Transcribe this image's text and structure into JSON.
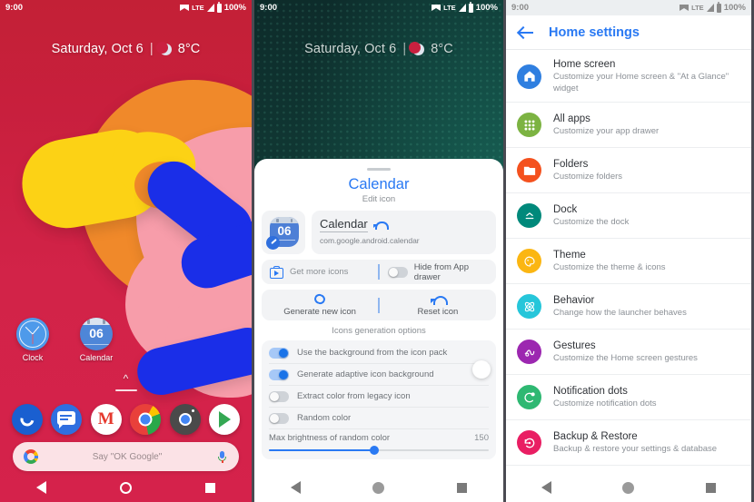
{
  "status_bar": {
    "time": "9:00",
    "network": "LTE",
    "battery": "100%",
    "wifi_icon": "wifi-icon",
    "signal_icon": "signal-icon",
    "battery_icon": "battery-icon"
  },
  "panel1": {
    "at_a_glance": {
      "date": "Saturday, Oct 6",
      "separator": "|",
      "weather_icon": "moon-icon",
      "temperature": "8°C"
    },
    "apps": [
      {
        "label": "Clock",
        "icon": "clock-icon"
      },
      {
        "label": "Calendar",
        "icon": "calendar-icon",
        "day": "06"
      }
    ],
    "page_up_icon": "chevron-up-icon",
    "dock": [
      {
        "name": "Phone",
        "icon": "phone-icon"
      },
      {
        "name": "Messages",
        "icon": "messages-icon"
      },
      {
        "name": "Gmail",
        "icon": "gmail-icon"
      },
      {
        "name": "Chrome",
        "icon": "chrome-icon"
      },
      {
        "name": "Camera",
        "icon": "camera-icon"
      },
      {
        "name": "Play Store",
        "icon": "play-store-icon"
      }
    ],
    "search": {
      "google_icon": "google-g-icon",
      "placeholder": "Say \"OK Google\"",
      "mic_icon": "microphone-icon"
    },
    "nav": {
      "back": "back-icon",
      "home": "home-icon",
      "recents": "recents-icon"
    }
  },
  "panel2": {
    "at_a_glance": {
      "date": "Saturday, Oct 6",
      "separator": "|",
      "weather_icon": "moon-icon",
      "temperature": "8°C"
    },
    "sheet": {
      "title": "Calendar",
      "subtitle": "Edit icon",
      "icon_preview": {
        "day": "06",
        "edit_badge": "brush-icon"
      },
      "app_name": "Calendar",
      "undo_icon": "undo-icon",
      "package": "com.google.android.calendar",
      "get_more_icons": {
        "label": "Get more icons",
        "icon": "store-icon"
      },
      "hide_from_drawer": {
        "label": "Hide from App drawer",
        "value": false
      },
      "actions": [
        {
          "label": "Generate new icon",
          "icon": "refresh-icon"
        },
        {
          "label": "Reset icon",
          "icon": "undo-icon"
        }
      ],
      "options_header": "Icons generation options",
      "options": [
        {
          "label": "Use the background from the icon pack",
          "value": true
        },
        {
          "label": "Generate adaptive icon background",
          "value": true,
          "swatch": "#ffffff"
        },
        {
          "label": "Extract color from legacy icon",
          "value": false
        },
        {
          "label": "Random color",
          "value": false
        }
      ],
      "slider": {
        "label": "Max brightness of random color",
        "value": "150",
        "percent": 48
      }
    },
    "nav": {
      "back": "back-icon",
      "home": "home-icon",
      "recents": "recents-icon"
    }
  },
  "panel3": {
    "appbar": {
      "back_icon": "back-arrow-icon",
      "title": "Home settings"
    },
    "items": [
      {
        "title": "Home screen",
        "subtitle": "Customize your Home screen & \"At a Glance\" widget",
        "icon": "house-icon",
        "color": "#2f7fe0"
      },
      {
        "title": "All apps",
        "subtitle": "Customize your app drawer",
        "icon": "grid-dots-icon",
        "color": "#7cb342"
      },
      {
        "title": "Folders",
        "subtitle": "Customize folders",
        "icon": "folder-icon",
        "color": "#f4511e"
      },
      {
        "title": "Dock",
        "subtitle": "Customize the dock",
        "icon": "dock-chevron-icon",
        "color": "#00897b"
      },
      {
        "title": "Theme",
        "subtitle": "Customize the theme & icons",
        "icon": "palette-icon",
        "color": "#fbb612"
      },
      {
        "title": "Behavior",
        "subtitle": "Change how the launcher behaves",
        "icon": "atom-icon",
        "color": "#26c6da"
      },
      {
        "title": "Gestures",
        "subtitle": "Customize the Home screen gestures",
        "icon": "gesture-icon",
        "color": "#9c27b0"
      },
      {
        "title": "Notification dots",
        "subtitle": "Customize notification dots",
        "icon": "notification-dot-icon",
        "color": "#2eb872"
      },
      {
        "title": "Backup & Restore",
        "subtitle": "Backup & restore your settings & database",
        "icon": "restore-icon",
        "color": "#e91e63"
      }
    ],
    "nav": {
      "back": "back-icon",
      "home": "home-icon",
      "recents": "recents-icon"
    }
  }
}
